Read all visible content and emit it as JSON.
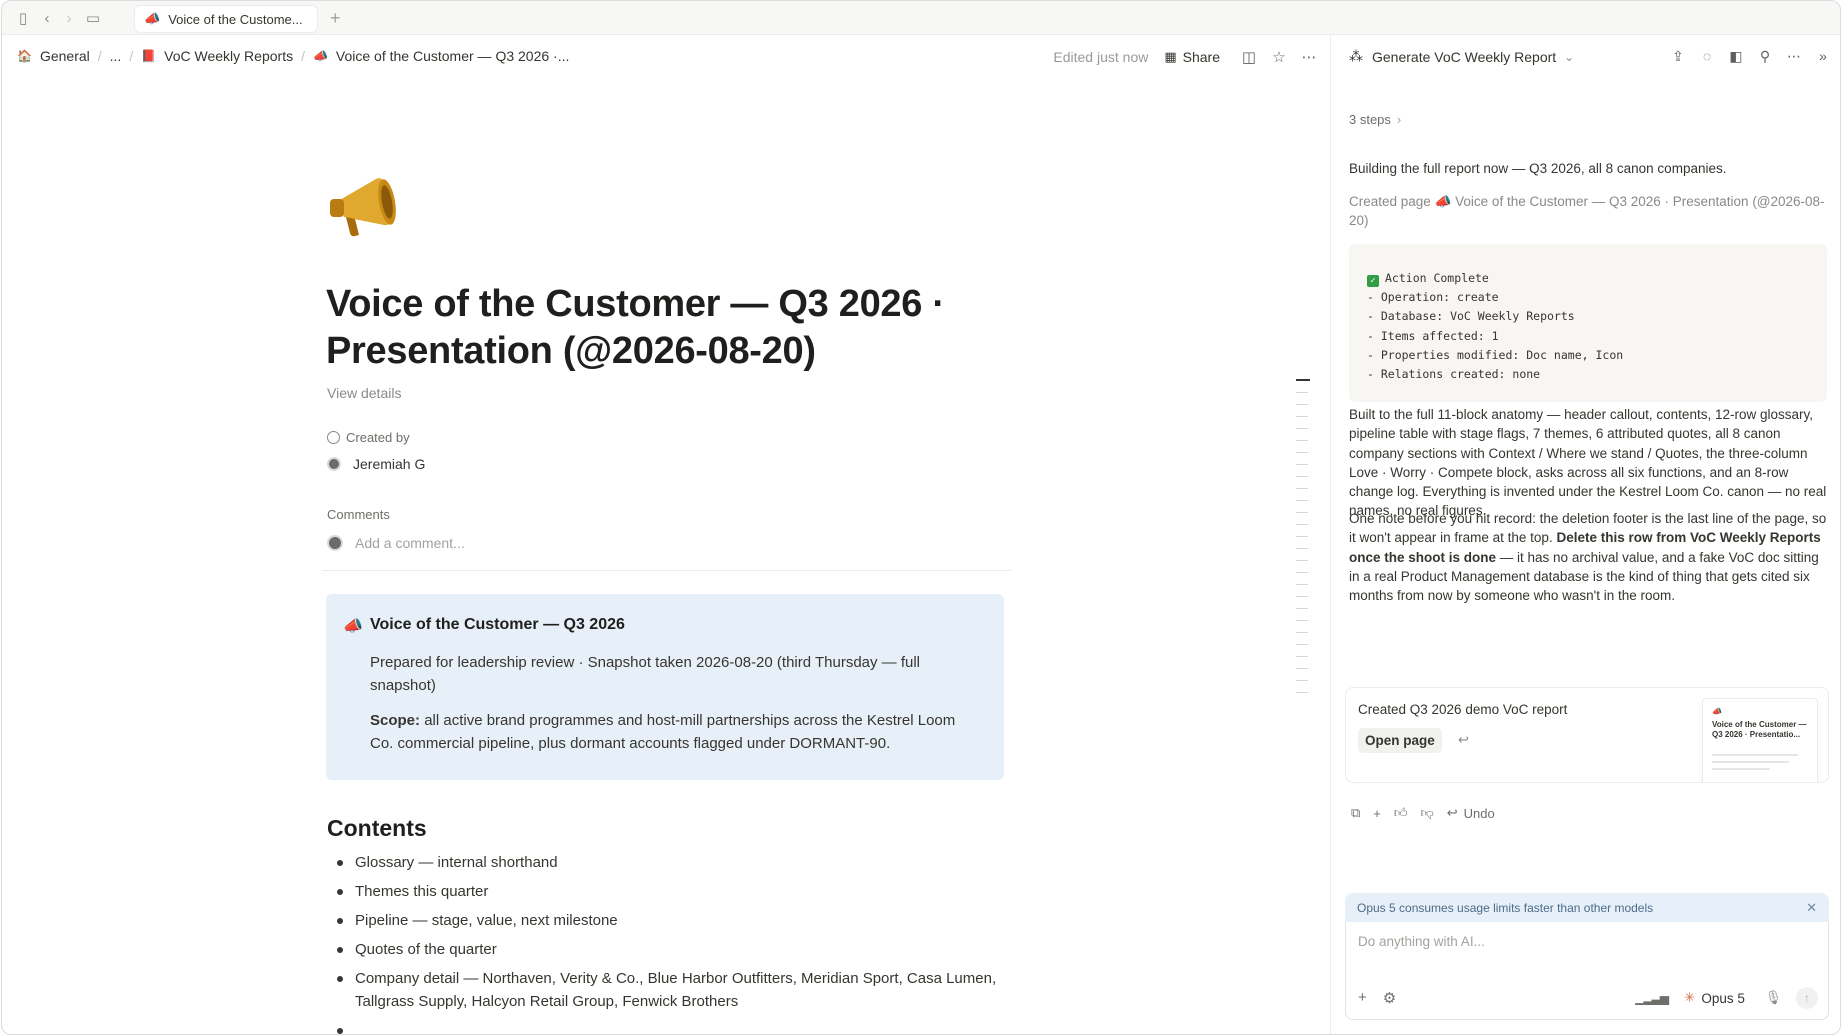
{
  "tabbar": {
    "tab_title": "Voice of the Custome...",
    "tab_icon": "megaphone-icon"
  },
  "breadcrumb": {
    "items": [
      {
        "label": "General",
        "icon": "home-icon"
      },
      {
        "label": "..."
      },
      {
        "label": "VoC Weekly Reports",
        "icon": "document-icon"
      },
      {
        "label": "Voice of the Customer — Q3 2026 ·...",
        "icon": "megaphone-icon"
      }
    ]
  },
  "topbar": {
    "edited": "Edited just now",
    "share": "Share"
  },
  "page": {
    "title": "Voice of the Customer — Q3 2026 · Presentation (@2026-08-20)",
    "view_details": "View details",
    "created_by_label": "Created by",
    "created_by_value": "Jeremiah G",
    "comments_label": "Comments",
    "comment_placeholder": "Add a comment..."
  },
  "callout": {
    "title": "Voice of the Customer — Q3 2026",
    "para1": "Prepared for leadership review · Snapshot taken 2026-08-20 (third Thursday — full snapshot)",
    "scope_label": "Scope:",
    "scope_text": "all active brand programmes and host-mill partnerships across the Kestrel Loom Co. commercial pipeline, plus dormant accounts flagged under DORMANT-90."
  },
  "contents": {
    "heading": "Contents",
    "items": [
      "Glossary — internal shorthand",
      "Themes this quarter",
      "Pipeline — stage, value, next milestone",
      "Quotes of the quarter",
      "Company detail — Northaven, Verity & Co., Blue Harbor Outfitters, Meridian Sport, Casa Lumen, Tallgrass Supply, Halcyon Retail Group, Fenwick Brothers"
    ]
  },
  "panel": {
    "title": "Generate VoC Weekly Report",
    "steps": "3 steps",
    "msg1": "Building the full report now — Q3 2026, all 8 canon companies.",
    "created_page_label": "Created page",
    "created_page_link": "Voice of the Customer — Q3 2026 · Presentation (@2026-08-20)",
    "code": {
      "status": "Action Complete",
      "lines": [
        "- Operation: create",
        "- Database: VoC Weekly Reports",
        "- Items affected: 1",
        "- Properties modified: Doc name, Icon",
        "- Relations created: none"
      ]
    },
    "msg2": "Built to the full 11-block anatomy — header callout, contents, 12-row glossary, pipeline table with stage flags, 7 themes, 6 attributed quotes, all 8 canon company sections with Context / Where we stand / Quotes, the three-column Love · Worry · Compete block, asks across all six functions, and an 8-row change log. Everything is invented under the Kestrel Loom Co. canon — no real names, no real figures.",
    "msg3_a": "One note before you hit record: the deletion footer is the last line of the page, so it won't appear in frame at the top.",
    "msg3_b": "Delete this row from VoC Weekly Reports once the shoot is done",
    "msg3_c": "— it has no archival value, and a fake VoC doc sitting in a real Product Management database is the kind of thing that gets cited six months from now by someone who wasn't in the room.",
    "card_title": "Created Q3 2026 demo VoC report",
    "open_page": "Open page",
    "thumb_title": "Voice of the Customer — Q3 2026 · Presentatio...",
    "undo": "Undo",
    "banner": "Opus 5 consumes usage limits faster than other models",
    "composer_placeholder": "Do anything with AI...",
    "model": "Opus 5"
  }
}
